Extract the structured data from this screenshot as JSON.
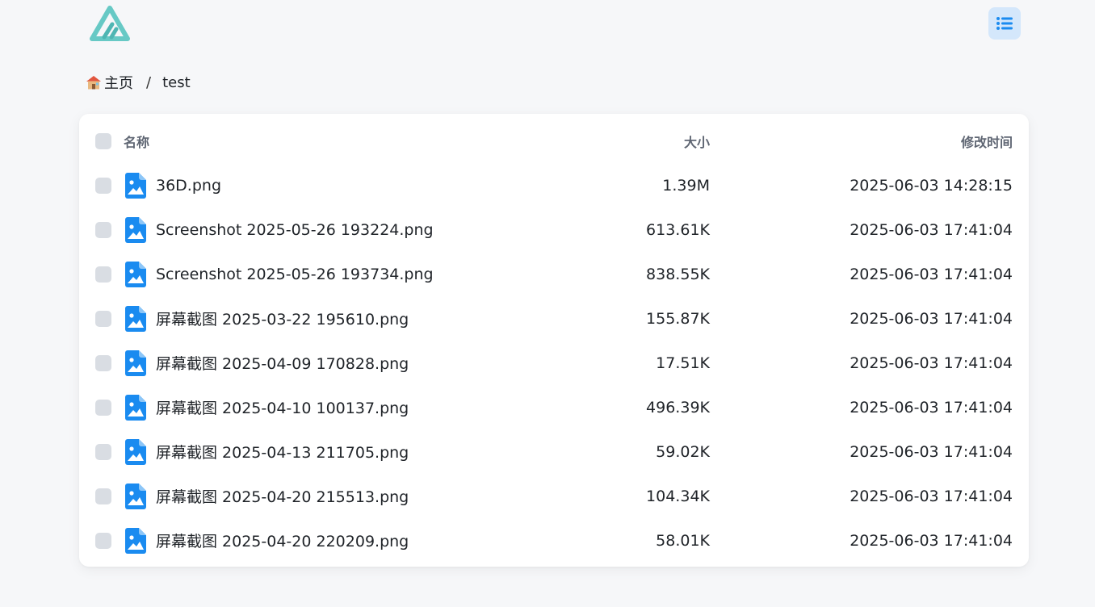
{
  "colors": {
    "accent": "#1a8bf0",
    "logo": "#67c9c5",
    "layout_button_bg": "#d4e7fb",
    "checkbox": "#d9dde3",
    "page_bg": "#f6f7f9"
  },
  "header": {
    "logo_icon": "logo-triangle-icon",
    "layout_toggle_icon": "list-layout-icon"
  },
  "breadcrumb": {
    "home_icon": "house-emoji-icon",
    "home_label": "主页",
    "separator": "/",
    "current": "test"
  },
  "table": {
    "columns": {
      "name": "名称",
      "size": "大小",
      "modified": "修改时间"
    },
    "rows": [
      {
        "name": "36D.png",
        "size": "1.39M",
        "modified": "2025-06-03 14:28:15",
        "icon": "image-file-icon"
      },
      {
        "name": "Screenshot 2025-05-26 193224.png",
        "size": "613.61K",
        "modified": "2025-06-03 17:41:04",
        "icon": "image-file-icon"
      },
      {
        "name": "Screenshot 2025-05-26 193734.png",
        "size": "838.55K",
        "modified": "2025-06-03 17:41:04",
        "icon": "image-file-icon"
      },
      {
        "name": "屏幕截图 2025-03-22 195610.png",
        "size": "155.87K",
        "modified": "2025-06-03 17:41:04",
        "icon": "image-file-icon"
      },
      {
        "name": "屏幕截图 2025-04-09 170828.png",
        "size": "17.51K",
        "modified": "2025-06-03 17:41:04",
        "icon": "image-file-icon"
      },
      {
        "name": "屏幕截图 2025-04-10 100137.png",
        "size": "496.39K",
        "modified": "2025-06-03 17:41:04",
        "icon": "image-file-icon"
      },
      {
        "name": "屏幕截图 2025-04-13 211705.png",
        "size": "59.02K",
        "modified": "2025-06-03 17:41:04",
        "icon": "image-file-icon"
      },
      {
        "name": "屏幕截图 2025-04-20 215513.png",
        "size": "104.34K",
        "modified": "2025-06-03 17:41:04",
        "icon": "image-file-icon"
      },
      {
        "name": "屏幕截图 2025-04-20 220209.png",
        "size": "58.01K",
        "modified": "2025-06-03 17:41:04",
        "icon": "image-file-icon"
      }
    ]
  }
}
